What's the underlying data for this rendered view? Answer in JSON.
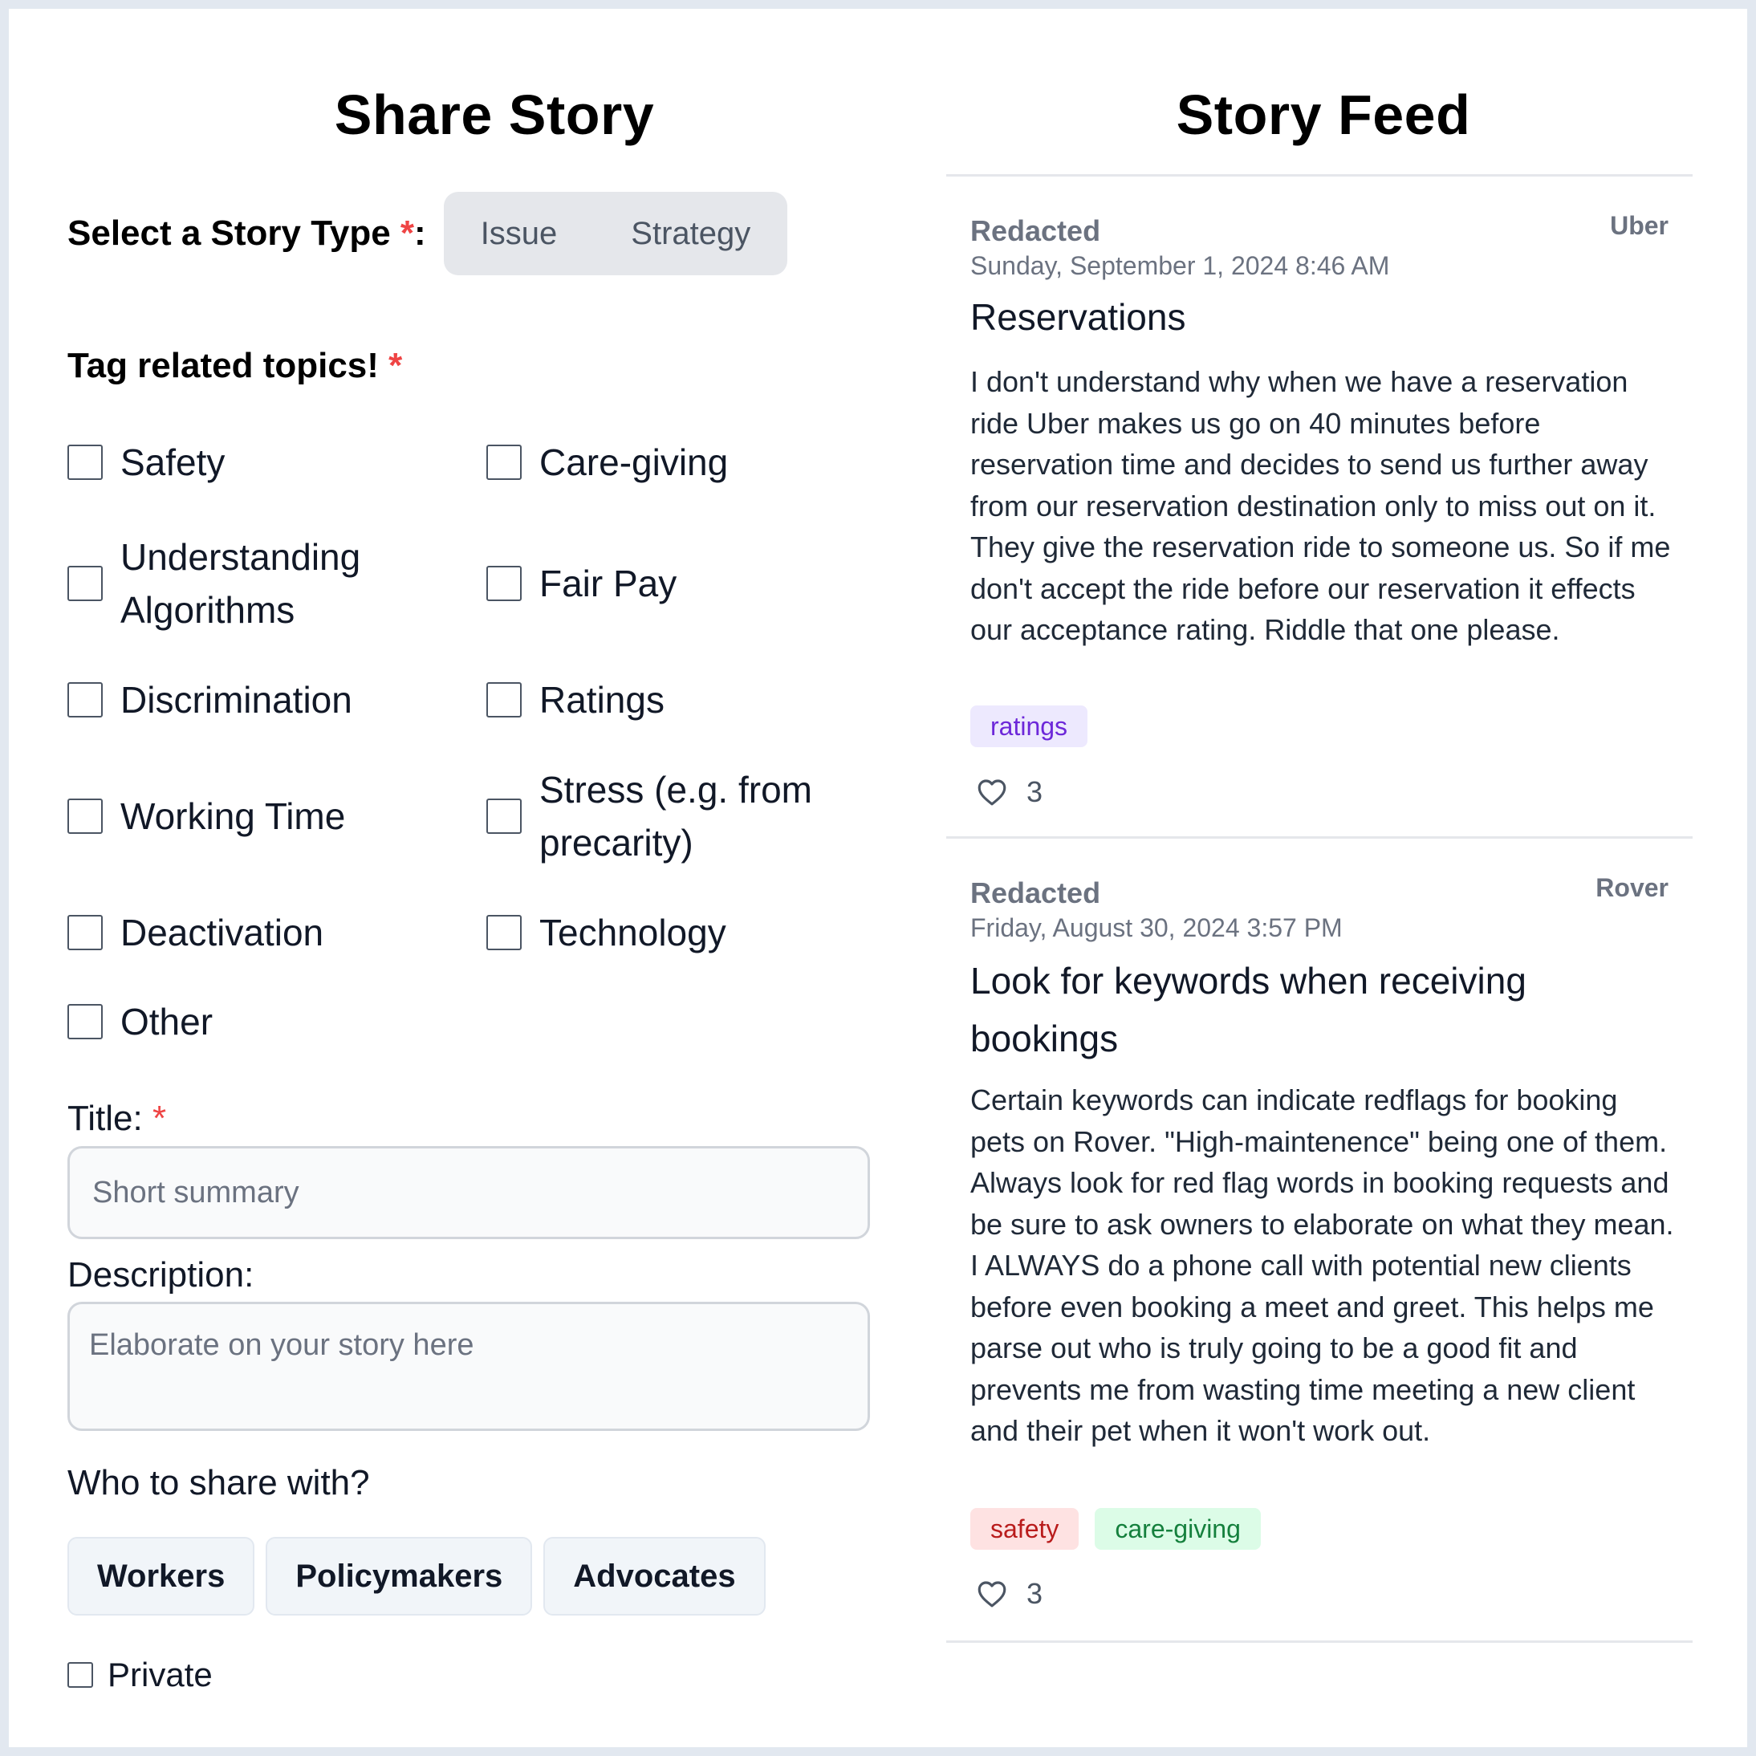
{
  "form": {
    "heading": "Share Story",
    "story_type": {
      "label": "Select a Story Type ",
      "required_mark": "*",
      "colon": ":",
      "options": [
        "Issue",
        "Strategy"
      ]
    },
    "topics": {
      "label": "Tag related topics! ",
      "required_mark": "*",
      "items": [
        {
          "label": "Safety",
          "checked": false
        },
        {
          "label": "Care-giving",
          "checked": false
        },
        {
          "label": "Understanding Algorithms",
          "checked": false
        },
        {
          "label": "Fair Pay",
          "checked": false
        },
        {
          "label": "Discrimination",
          "checked": false
        },
        {
          "label": "Ratings",
          "checked": false
        },
        {
          "label": "Working Time",
          "checked": false
        },
        {
          "label": "Stress (e.g. from precarity)",
          "checked": false
        },
        {
          "label": "Deactivation",
          "checked": false
        },
        {
          "label": "Technology",
          "checked": false
        },
        {
          "label": "Other",
          "checked": false
        }
      ]
    },
    "title_field": {
      "label": "Title: ",
      "required_mark": "*",
      "value": "",
      "placeholder": "Short summary"
    },
    "description_field": {
      "label": "Description:",
      "value": "",
      "placeholder": "Elaborate on your story here"
    },
    "share": {
      "label": "Who to share with?",
      "options": [
        "Workers",
        "Policymakers",
        "Advocates"
      ]
    },
    "private": {
      "label": "Private",
      "checked": false
    }
  },
  "feed": {
    "heading": "Story Feed",
    "stories": [
      {
        "author": "Redacted",
        "platform": "Uber",
        "date": "Sunday, September 1, 2024 8:46 AM",
        "title": "Reservations",
        "body": "I don't understand why when we have a reservation ride Uber makes us go on 40 minutes before reservation time and decides to send us further away from our reservation destination only to miss out on it. They give the reservation ride to someone us. So if me don't accept the ride before our reservation it effects our acceptance rating. Riddle that one please.",
        "tags": [
          {
            "label": "ratings",
            "color": "#6d28d9"
          }
        ],
        "likes": "3"
      },
      {
        "author": "Redacted",
        "platform": "Rover",
        "date": "Friday, August 30, 2024 3:57 PM",
        "title": "Look for keywords when receiving bookings",
        "body": "Certain keywords can indicate redflags for booking pets on Rover. \"High-maintenence\" being one of them. Always look for red flag words in booking requests and be sure to ask owners to elaborate on what they mean. I ALWAYS do a phone call with potential new clients before even booking a meet and greet. This helps me parse out who is truly going to be a good fit and prevents me from wasting time meeting a new client and their pet when it won't work out.",
        "tags": [
          {
            "label": "safety",
            "color": "#b91c1c"
          },
          {
            "label": "care-giving",
            "color": "#15803d"
          }
        ],
        "likes": "3"
      }
    ]
  },
  "colors": {
    "required": "#ef4444",
    "page_border": "#e2e8f0",
    "muted_text": "#6b7280"
  },
  "icons": {
    "like": "heart-outline-icon"
  }
}
